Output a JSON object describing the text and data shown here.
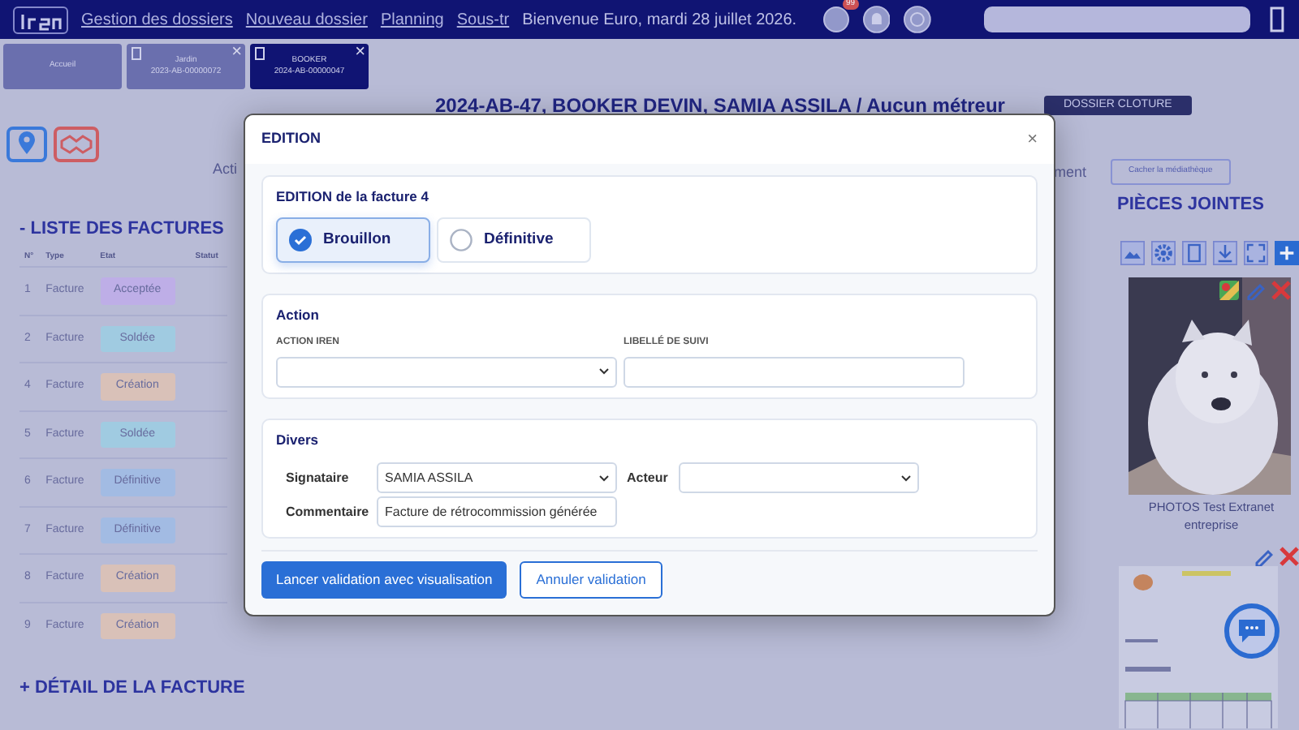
{
  "navbar": {
    "nav_items": [
      "Gestion des dossiers",
      "Nouveau dossier",
      "Planning",
      "Sous-tr"
    ],
    "welcome": "Bienvenue Euro, mardi 28 juillet 2026.",
    "notification_badge": "99"
  },
  "tabs": [
    {
      "label": "Accueil",
      "selected": false
    },
    {
      "label": "Jardin",
      "sub": "2023-AB-00000072",
      "close": "×",
      "selected": false
    },
    {
      "label": "BOOKER",
      "sub": "2024-AB-00000047",
      "close": "×",
      "selected": true
    }
  ],
  "dossier": {
    "title": "2024-AB-47, BOOKER DEVIN, SAMIA ASSILA / Aucun métreur",
    "status": "DOSSIER CLOTURE",
    "left_text": "Acti",
    "right_text": "ment",
    "media_button": "Cacher la médiathèque"
  },
  "invoices": {
    "title": "- LISTE DES FACTURES",
    "columns": [
      "N°",
      "Type",
      "Etat",
      "Statut"
    ],
    "rows": [
      {
        "number": "1",
        "type": "Facture",
        "state": "Acceptée",
        "color": "#c9b8ee"
      },
      {
        "number": "2",
        "type": "Facture",
        "state": "Soldée",
        "color": "#a9d7e8"
      },
      {
        "number": "4",
        "type": "Facture",
        "state": "Création",
        "color": "#e6cdbb"
      },
      {
        "number": "5",
        "type": "Facture",
        "state": "Soldée",
        "color": "#a9d7e8"
      },
      {
        "number": "6",
        "type": "Facture",
        "state": "Définitive",
        "color": "#abc6ea"
      },
      {
        "number": "7",
        "type": "Facture",
        "state": "Définitive",
        "color": "#abc6ea"
      },
      {
        "number": "8",
        "type": "Facture",
        "state": "Création",
        "color": "#e6cdbb"
      },
      {
        "number": "9",
        "type": "Facture",
        "state": "Création",
        "color": "#e6cdbb"
      }
    ],
    "detail_title": "+ DÉTAIL DE LA FACTURE"
  },
  "attachments": {
    "title": "PIÈCES JOINTES",
    "photo": {
      "kind": "picture",
      "caption": "PHOTOS Test Extranet entreprise"
    }
  },
  "modal": {
    "title": "EDITION",
    "close": "×",
    "edition": {
      "title": "EDITION de la facture 4",
      "options": [
        {
          "label": "Brouillon",
          "selected": true
        },
        {
          "label": "Définitive",
          "selected": false
        }
      ]
    },
    "action": {
      "title": "Action",
      "fields": [
        {
          "label": "ACTION IREN",
          "kind": "select"
        },
        {
          "label": "LIBELLÉ DE SUIVI",
          "kind": "text"
        }
      ]
    },
    "divers": {
      "title": "Divers",
      "signataire": {
        "label": "Signataire",
        "value": "SAMIA ASSILA"
      },
      "acteur": {
        "label": "Acteur"
      },
      "commentaire": {
        "label": "Commentaire",
        "value": "Facture de rétrocommission générée"
      }
    },
    "buttons": [
      {
        "label": "Lancer validation avec visualisation",
        "kind": "primary"
      },
      {
        "label": "Annuler validation",
        "kind": "outline"
      }
    ]
  }
}
